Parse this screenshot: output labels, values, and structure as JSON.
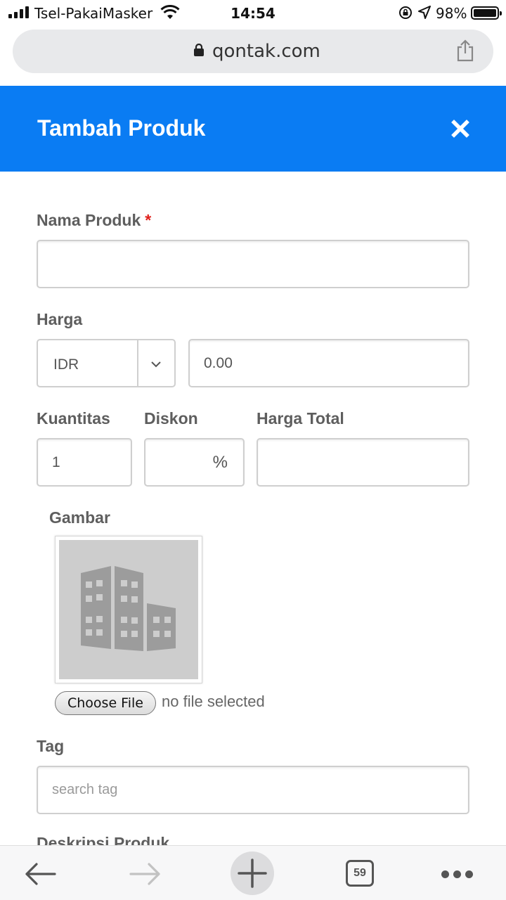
{
  "status": {
    "carrier": "Tsel-PakaiMasker",
    "time": "14:54",
    "battery_percent": "98%",
    "battery_level": 0.98
  },
  "browser": {
    "url": "qontak.com",
    "tab_count": "59"
  },
  "modal": {
    "title": "Tambah Produk",
    "accent_color": "#0a7cf3"
  },
  "form": {
    "product_name": {
      "label": "Nama Produk",
      "required_mark": "*",
      "value": ""
    },
    "price": {
      "label": "Harga",
      "currency": "IDR",
      "value": "0.00"
    },
    "quantity": {
      "label": "Kuantitas",
      "value": "1"
    },
    "discount": {
      "label": "Diskon",
      "suffix": "%",
      "value": ""
    },
    "total_price": {
      "label": "Harga Total",
      "value": ""
    },
    "image": {
      "label": "Gambar",
      "choose_file_label": "Choose File",
      "file_status": "no file selected"
    },
    "tag": {
      "label": "Tag",
      "placeholder": "search tag"
    },
    "description": {
      "label": "Deskripsi Produk"
    }
  }
}
